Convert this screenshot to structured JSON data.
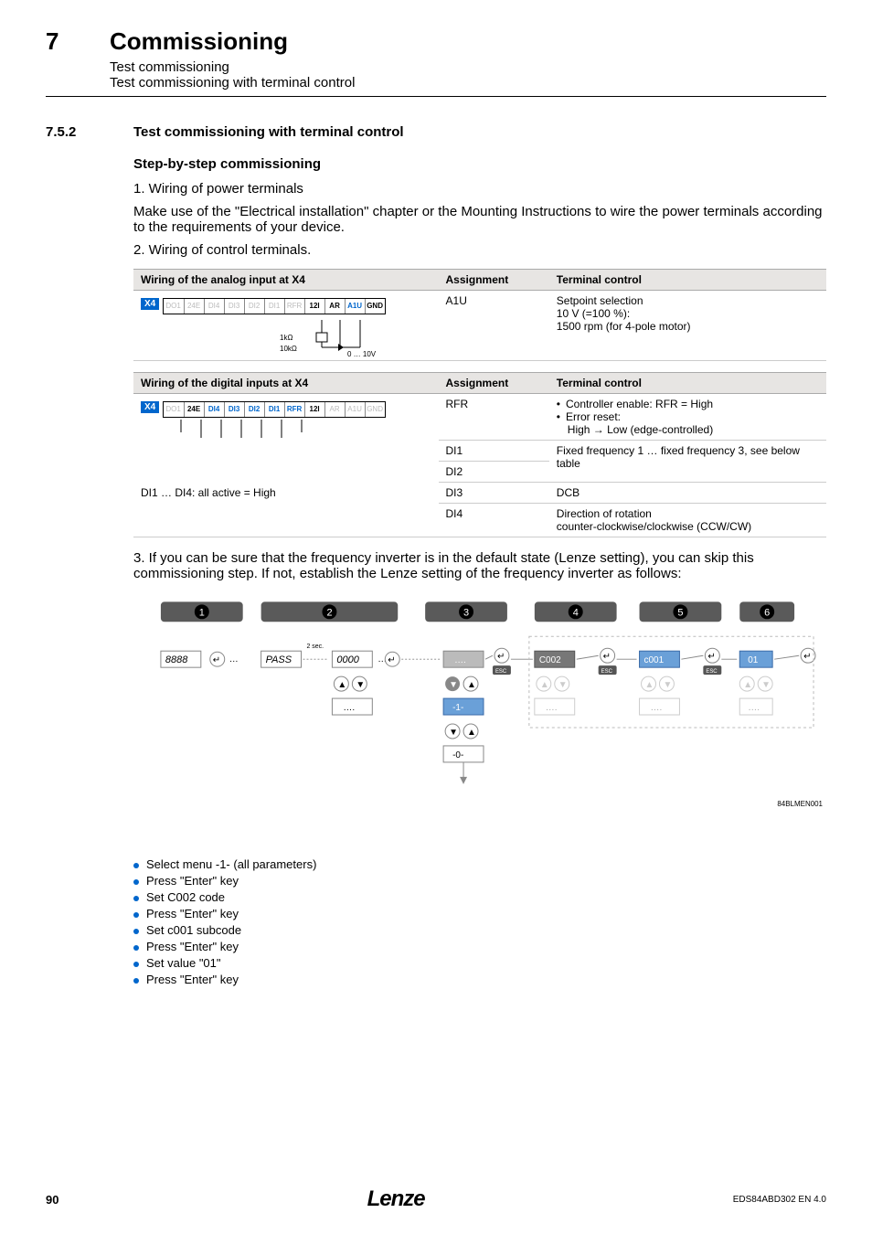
{
  "chapter": {
    "num": "7",
    "title": "Commissioning",
    "sub1": "Test commissioning",
    "sub2": "Test commissioning with terminal control"
  },
  "section": {
    "num": "7.5.2",
    "title": "Test commissioning with terminal control"
  },
  "stepTitle": "Step-by-step commissioning",
  "items": {
    "n1": "1.  Wiring of power terminals",
    "p1": "Make use of the \"Electrical installation\" chapter or the Mounting Instructions to wire the power terminals according to the requirements of your device.",
    "n2": "2.  Wiring of control terminals.",
    "n3": "3.  If you can be sure that the frequency inverter is in the default state (Lenze setting), you can skip this commissioning step. If not, establish the Lenze setting of the frequency inverter as follows:"
  },
  "tableA": {
    "h1": "Wiring of the analog input at X4",
    "h2": "Assignment",
    "h3": "Terminal control",
    "x4": "X4",
    "cells": [
      "DO1",
      "24E",
      "DI4",
      "DI3",
      "DI2",
      "DI1",
      "RFR",
      "12I",
      "AR",
      "A1U",
      "GND"
    ],
    "extra1": "1kΩ",
    "extra2": "10kΩ",
    "extra3": "0 … 10V",
    "assign": "A1U",
    "tc1": "Setpoint selection",
    "tc2": "10 V (=100 %):",
    "tc3": "1500 rpm (for 4-pole motor)"
  },
  "tableB": {
    "h1": "Wiring of the digital inputs at X4",
    "h2": "Assignment",
    "h3": "Terminal control",
    "x4": "X4",
    "cells": [
      "DO1",
      "24E",
      "DI4",
      "DI3",
      "DI2",
      "DI1",
      "RFR",
      "12I",
      "AR",
      "A1U",
      "GND"
    ],
    "note": "DI1 … DI4: all active = High",
    "r1a": "RFR",
    "r1b1": "Controller enable: RFR = High",
    "r1b2": "Error reset:",
    "r1b3": "High → Low (edge-controlled)",
    "r2a": "DI1",
    "r2b": "Fixed frequency 1 … fixed frequency 3, see below table",
    "r3a": "DI2",
    "r4a": "DI3",
    "r4b": "DCB",
    "r5a": "DI4",
    "r5b": "Direction of rotation",
    "r5c": "counter-clockwise/clockwise (CCW/CW)"
  },
  "diagram": {
    "steps": [
      "1",
      "2",
      "3",
      "4",
      "5",
      "6"
    ],
    "d1": "8888",
    "d2a": "PASS",
    "d2sec": "2 sec.",
    "d2b": "0000",
    "d3a": "….",
    "d3m1": "-1-",
    "d3m0": "-0-",
    "d4a": "C002",
    "d4b": "….",
    "d5a": "c001",
    "d5b": "….",
    "d6a": "01",
    "d6b": "….",
    "ellipsis": "….",
    "esc": "ESC",
    "ref": "84BLMEN001"
  },
  "bullets": {
    "b1": "Select menu -1- (all parameters)",
    "b2": "Press \"Enter\" key",
    "b3": "Set C002 code",
    "b4": "Press \"Enter\" key",
    "b5": "Set c001 subcode",
    "b6": "Press \"Enter\" key",
    "b7": "Set value \"01\"",
    "b8": "Press \"Enter\" key"
  },
  "footer": {
    "page": "90",
    "logo": "Lenze",
    "code": "EDS84ABD302 EN 4.0"
  }
}
